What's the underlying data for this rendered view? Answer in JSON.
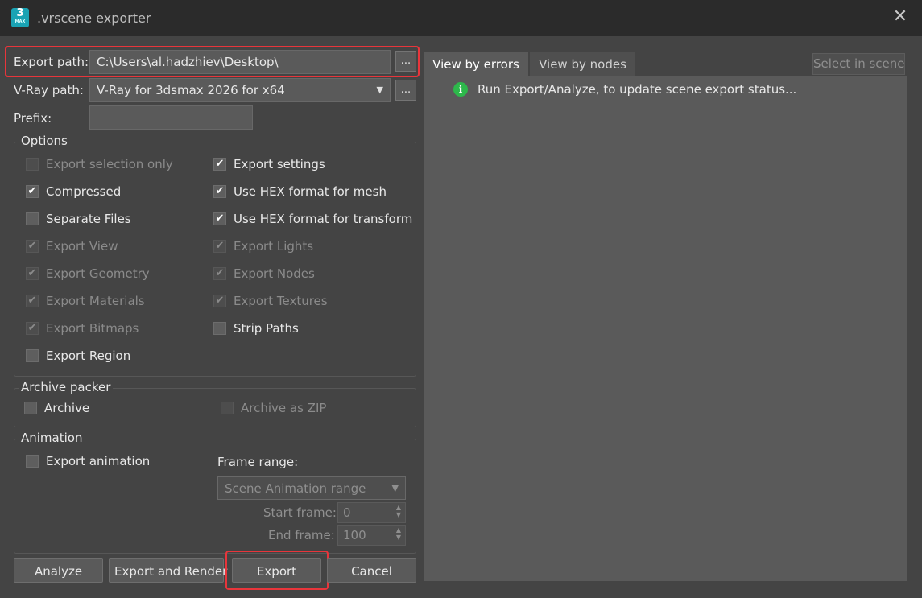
{
  "window": {
    "title": ".vrscene exporter",
    "app_icon": {
      "label": "3",
      "sublabel": "MAX"
    },
    "close_glyph": "✕"
  },
  "export_path": {
    "label": "Export path:",
    "value": "C:\\Users\\al.hadzhiev\\Desktop\\",
    "browse": "..."
  },
  "vray_path": {
    "label": "V-Ray path:",
    "value": "V-Ray for 3dsmax 2026 for x64",
    "browse": "..."
  },
  "prefix": {
    "label": "Prefix:",
    "value": ""
  },
  "options": {
    "title": "Options",
    "items": [
      {
        "label": "Export selection only",
        "checked": false,
        "enabled": false
      },
      {
        "label": "Export settings",
        "checked": true,
        "enabled": true
      },
      {
        "label": "Compressed",
        "checked": true,
        "enabled": true
      },
      {
        "label": "Use HEX format for mesh",
        "checked": true,
        "enabled": true
      },
      {
        "label": "Separate Files",
        "checked": false,
        "enabled": true
      },
      {
        "label": "Use HEX format for transform",
        "checked": true,
        "enabled": true
      },
      {
        "label": "Export View",
        "checked": true,
        "enabled": false
      },
      {
        "label": "Export Lights",
        "checked": true,
        "enabled": false
      },
      {
        "label": "Export Geometry",
        "checked": true,
        "enabled": false
      },
      {
        "label": "Export Nodes",
        "checked": true,
        "enabled": false
      },
      {
        "label": "Export Materials",
        "checked": true,
        "enabled": false
      },
      {
        "label": "Export Textures",
        "checked": true,
        "enabled": false
      },
      {
        "label": "Export Bitmaps",
        "checked": true,
        "enabled": false
      },
      {
        "label": "Strip Paths",
        "checked": false,
        "enabled": true
      },
      {
        "label": "Export Region",
        "checked": false,
        "enabled": true
      }
    ]
  },
  "archive": {
    "title": "Archive packer",
    "archive": {
      "label": "Archive",
      "checked": false,
      "enabled": true
    },
    "zip": {
      "label": "Archive as ZIP",
      "checked": false,
      "enabled": false
    }
  },
  "animation": {
    "title": "Animation",
    "export_animation": {
      "label": "Export animation",
      "checked": false,
      "enabled": true
    },
    "frame_range_label": "Frame range:",
    "frame_range_value": "Scene Animation range",
    "start_label": "Start frame:",
    "start_value": "0",
    "end_label": "End frame:",
    "end_value": "100"
  },
  "buttons": {
    "analyze": "Analyze",
    "export_render": "Export and Render",
    "export": "Export",
    "cancel": "Cancel"
  },
  "tabs": [
    {
      "label": "View by errors",
      "active": true
    },
    {
      "label": "View by nodes",
      "active": false
    }
  ],
  "select_in_scene": "Select in scene",
  "status": {
    "message": "Run Export/Analyze, to update scene export status...",
    "icon": "info-icon",
    "icon_glyph": "i"
  },
  "glyphs": {
    "check": "✔",
    "dropdown": "▼",
    "spin_up": "▲",
    "spin_down": "▼"
  },
  "colors": {
    "highlight": "#e8353b",
    "info": "#2db84b"
  }
}
